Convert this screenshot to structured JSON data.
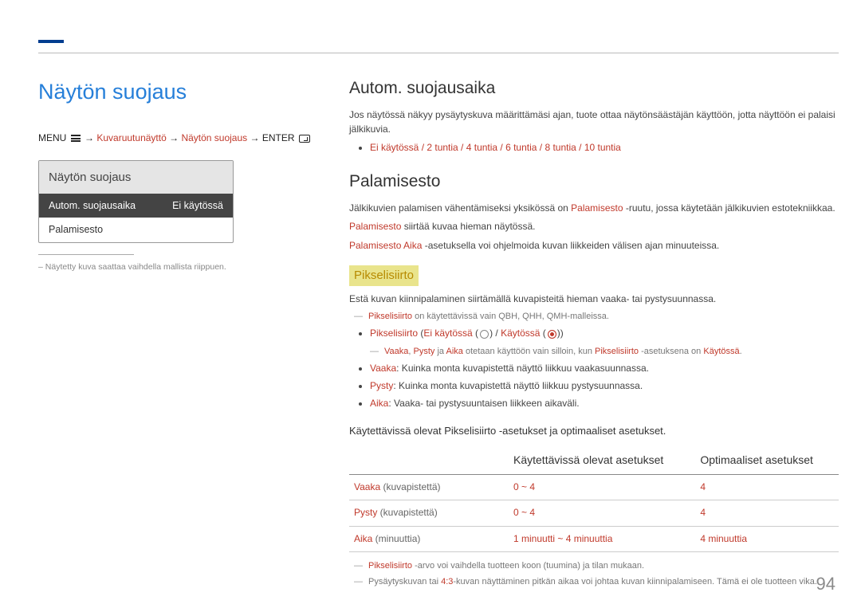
{
  "page_title": "Näytön suojaus",
  "breadcrumb": {
    "menu": "MENU",
    "l1": "Kuvaruutunäyttö",
    "l2": "Näytön suojaus",
    "enter": "ENTER"
  },
  "menu_panel": {
    "title": "Näytön suojaus",
    "rows": [
      {
        "label": "Autom. suojausaika",
        "value": "Ei käytössä"
      },
      {
        "label": "Palamisesto",
        "value": ""
      }
    ]
  },
  "note_left": "Näytetty kuva saattaa vaihdella mallista riippuen.",
  "section1": {
    "title": "Autom. suojausaika",
    "para": "Jos näytössä näkyy pysäytyskuva määrittämäsi ajan, tuote ottaa näytönsäästäjän käyttöön, jotta näyttöön ei palaisi jälkikuvia.",
    "options": "Ei käytössä / 2 tuntia / 4 tuntia / 6 tuntia / 8 tuntia / 10 tuntia"
  },
  "section2": {
    "title": "Palamisesto",
    "para1_pre": "Jälkikuvien palamisen vähentämiseksi yksikössä on ",
    "para1_red": "Palamisesto",
    "para1_post": " -ruutu, jossa käytetään jälkikuvien estotekniikkaa.",
    "para2_red": "Palamisesto",
    "para2_post": " siirtää kuvaa hieman näytössä.",
    "para3_red": "Palamisesto Aika",
    "para3_post": " -asetuksella voi ohjelmoida kuvan liikkeiden välisen ajan minuuteissa."
  },
  "section3": {
    "title": "Pikselisiirto",
    "para": "Estä kuvan kiinnipalaminen siirtämällä kuvapisteitä hieman vaaka- tai pystysuunnassa.",
    "subnote1_red": "Pikselisiirto",
    "subnote1_text": " on käytettävissä vain QBH, QHH, QMH-malleissa.",
    "bullet_pix_label": "Pikselisiirto",
    "bullet_pix_off": "Ei käytössä",
    "bullet_pix_on": "Käytössä",
    "subnote2_parts": {
      "vaaka": "Vaaka",
      "pysty": "Pysty",
      "ja": " ja ",
      "aika": "Aika",
      "mid": " otetaan käyttöön vain silloin, kun ",
      "pix": "Pikselisiirto",
      "mid2": " -asetuksena on ",
      "kay": "Käytössä",
      "dot": "."
    },
    "bullets": [
      {
        "red": "Vaaka",
        "text": ": Kuinka monta kuvapistettä näyttö liikkuu vaakasuunnassa."
      },
      {
        "red": "Pysty",
        "text": ": Kuinka monta kuvapistettä näyttö liikkuu pystysuunnassa."
      },
      {
        "red": "Aika",
        "text": ": Vaaka- tai pystysuuntaisen liikkeen aikaväli."
      }
    ]
  },
  "table": {
    "caption": "Käytettävissä olevat Pikselisiirto -asetukset ja optimaaliset asetukset.",
    "headers": [
      "",
      "Käytettävissä olevat asetukset",
      "Optimaaliset asetukset"
    ],
    "rows": [
      {
        "label_red": "Vaaka",
        "label_grey": " (kuvapistettä)",
        "avail": "0 ~ 4",
        "opt": "4"
      },
      {
        "label_red": "Pysty",
        "label_grey": " (kuvapistettä)",
        "avail": "0 ~ 4",
        "opt": "4"
      },
      {
        "label_red": "Aika",
        "label_grey": " (minuuttia)",
        "avail": "1 minuutti ~ 4 minuuttia",
        "opt": "4 minuuttia"
      }
    ]
  },
  "footnotes": {
    "f1_red": "Pikselisiirto",
    "f1_text": " -arvo voi vaihdella tuotteen koon (tuumina) ja tilan mukaan.",
    "f2_pre": "Pysäytyskuvan tai ",
    "f2_ratio": "4:3",
    "f2_post": "-kuvan näyttäminen pitkän aikaa voi johtaa kuvan kiinnipalamiseen. Tämä ei ole tuotteen vika."
  },
  "page_number": "94"
}
